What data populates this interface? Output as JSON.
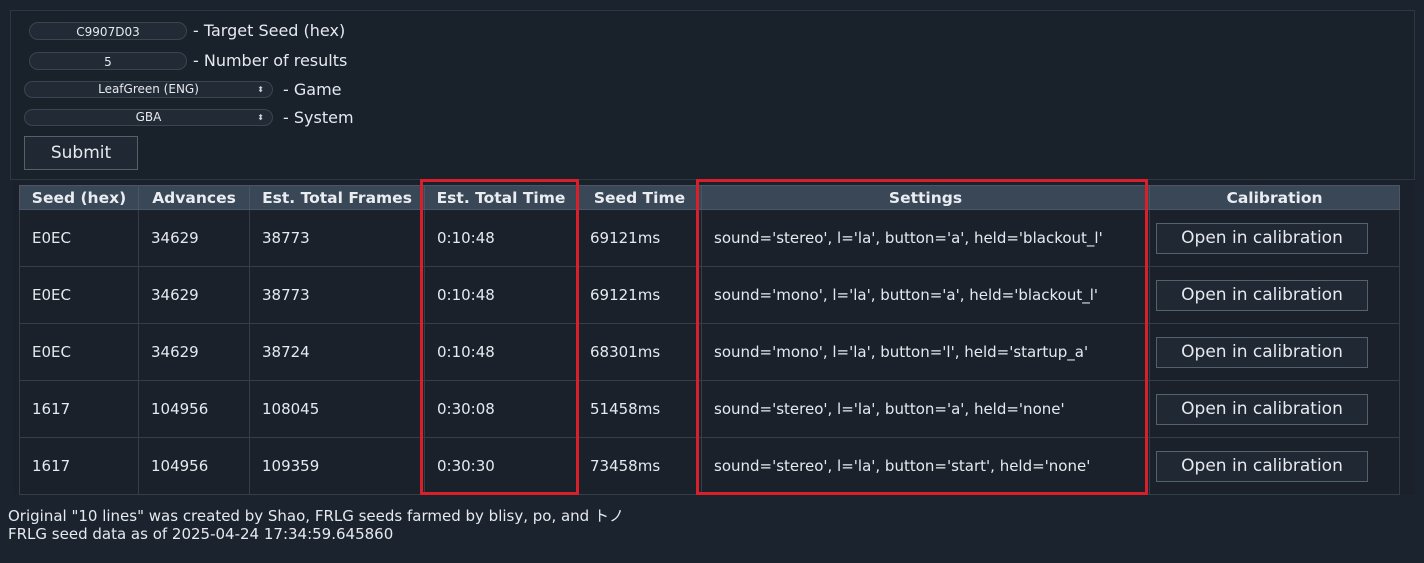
{
  "form": {
    "seed_value": "C9907D03",
    "seed_label": "- Target Seed (hex)",
    "results_value": "5",
    "results_label": "- Number of results",
    "game_value": "LeafGreen (ENG)",
    "game_label": "- Game",
    "system_value": "GBA",
    "system_label": "- System",
    "submit_label": "Submit"
  },
  "table": {
    "headers": [
      "Seed (hex)",
      "Advances",
      "Est. Total Frames",
      "Est. Total Time",
      "Seed Time",
      "Settings",
      "Calibration"
    ],
    "rows": [
      {
        "seed": "E0EC",
        "advances": "34629",
        "frames": "38773",
        "time": "0:10:48",
        "seed_time": "69121ms",
        "settings": "sound='stereo', l='la', button='a', held='blackout_l'",
        "calibration": "Open in calibration"
      },
      {
        "seed": "E0EC",
        "advances": "34629",
        "frames": "38773",
        "time": "0:10:48",
        "seed_time": "69121ms",
        "settings": "sound='mono', l='la', button='a', held='blackout_l'",
        "calibration": "Open in calibration"
      },
      {
        "seed": "E0EC",
        "advances": "34629",
        "frames": "38724",
        "time": "0:10:48",
        "seed_time": "68301ms",
        "settings": "sound='mono', l='la', button='l', held='startup_a'",
        "calibration": "Open in calibration"
      },
      {
        "seed": "1617",
        "advances": "104956",
        "frames": "108045",
        "time": "0:30:08",
        "seed_time": "51458ms",
        "settings": "sound='stereo', l='la', button='a', held='none'",
        "calibration": "Open in calibration"
      },
      {
        "seed": "1617",
        "advances": "104956",
        "frames": "109359",
        "time": "0:30:30",
        "seed_time": "73458ms",
        "settings": "sound='stereo', l='la', button='start', held='none'",
        "calibration": "Open in calibration"
      }
    ]
  },
  "footer": {
    "credit": "Original \"10 lines\" was created by Shao, FRLG seeds farmed by blisy, po, and トノ",
    "data_date": "FRLG seed data as of 2025-04-24 17:34:59.645860"
  },
  "colors": {
    "highlight": "#d81f2a",
    "background": "#1b232e",
    "header": "#3a4756"
  }
}
